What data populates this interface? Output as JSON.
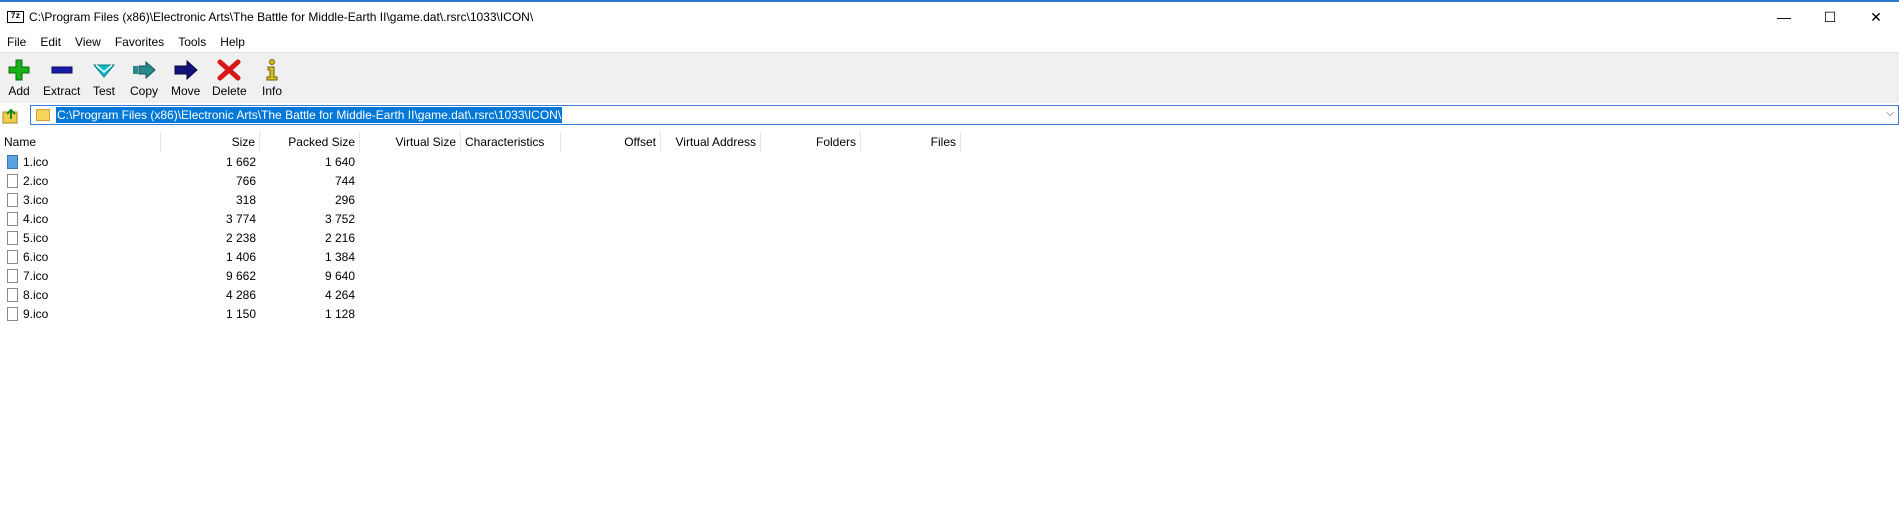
{
  "window": {
    "app_icon_text": "7z",
    "title": "C:\\Program Files (x86)\\Electronic Arts\\The Battle for Middle-Earth II\\game.dat\\.rsrc\\1033\\ICON\\",
    "minimize": "—",
    "maximize": "☐",
    "close": "✕"
  },
  "menu": [
    "File",
    "Edit",
    "View",
    "Favorites",
    "Tools",
    "Help"
  ],
  "toolbar": {
    "add": "Add",
    "extract": "Extract",
    "test": "Test",
    "copy": "Copy",
    "move": "Move",
    "delete": "Delete",
    "info": "Info"
  },
  "address": {
    "path": "C:\\Program Files (x86)\\Electronic Arts\\The Battle for Middle-Earth II\\game.dat\\.rsrc\\1033\\ICON\\",
    "dropdown": "⌵"
  },
  "columns": [
    "Name",
    "Size",
    "Packed Size",
    "Virtual Size",
    "Characteristics",
    "Offset",
    "Virtual Address",
    "Folders",
    "Files"
  ],
  "files": [
    {
      "name": "1.ico",
      "size": "1 662",
      "packed": "1 640"
    },
    {
      "name": "2.ico",
      "size": "766",
      "packed": "744"
    },
    {
      "name": "3.ico",
      "size": "318",
      "packed": "296"
    },
    {
      "name": "4.ico",
      "size": "3 774",
      "packed": "3 752"
    },
    {
      "name": "5.ico",
      "size": "2 238",
      "packed": "2 216"
    },
    {
      "name": "6.ico",
      "size": "1 406",
      "packed": "1 384"
    },
    {
      "name": "7.ico",
      "size": "9 662",
      "packed": "9 640"
    },
    {
      "name": "8.ico",
      "size": "4 286",
      "packed": "4 264"
    },
    {
      "name": "9.ico",
      "size": "1 150",
      "packed": "1 128"
    }
  ],
  "colors": {
    "accent": "#0078d7",
    "add_icon": "#19b019",
    "extract_icon": "#1a1aa8",
    "test_icon": "#16b8c8",
    "copy_icon": "#2a8a8a",
    "move_icon": "#12127a",
    "delete_icon": "#d81818",
    "info_icon": "#d8c21a",
    "folder": "#f7d35b"
  }
}
